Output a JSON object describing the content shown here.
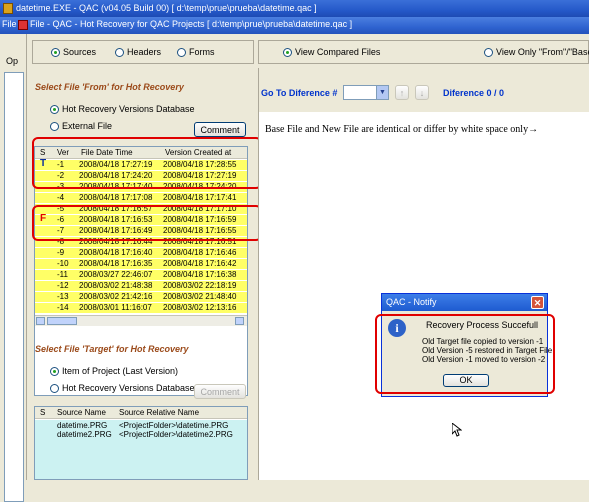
{
  "window": {
    "app_title": "datetime.EXE - QAC (v04.05 Build 00) [ d:\\temp\\prue\\prueba\\datetime.qac ]",
    "child_title": "File - QAC - Hot Recovery for QAC Projects [ d:\\temp\\prue\\prueba\\datetime.qac ]",
    "menu_file": "File",
    "side_label": "Op"
  },
  "top_tabs": {
    "sources": "Sources",
    "headers": "Headers",
    "forms": "Forms",
    "selected": "sources"
  },
  "view_options": {
    "compared": "View Compared Files",
    "only": "View Only \"From\"/\"Base\"",
    "selected": "compared"
  },
  "from_section": {
    "title": "Select File 'From' for Hot Recovery",
    "opt_db": "Hot Recovery Versions Database",
    "opt_ext": "External File",
    "selected": "db",
    "comment_button": "Comment",
    "columns": [
      "S",
      "Ver",
      "File Date Time",
      "Version Created at"
    ],
    "rows": [
      {
        "s": "T",
        "ver": "-1",
        "fdt": "2008/04/18 17:27:19",
        "created": "2008/04/18 17:28:55"
      },
      {
        "s": "",
        "ver": "-2",
        "fdt": "2008/04/18 17:24:20",
        "created": "2008/04/18 17:27:19"
      },
      {
        "s": "",
        "ver": "-3",
        "fdt": "2008/04/18 17:17:40",
        "created": "2008/04/18 17:24:20"
      },
      {
        "s": "",
        "ver": "-4",
        "fdt": "2008/04/18 17:17:08",
        "created": "2008/04/18 17:17:41"
      },
      {
        "s": "",
        "ver": "-5",
        "fdt": "2008/04/18 17:16:57",
        "created": "2008/04/18 17:17:10"
      },
      {
        "s": "F",
        "ver": "-6",
        "fdt": "2008/04/18 17:16:53",
        "created": "2008/04/18 17:16:59"
      },
      {
        "s": "",
        "ver": "-7",
        "fdt": "2008/04/18 17:16:49",
        "created": "2008/04/18 17:16:55"
      },
      {
        "s": "",
        "ver": "-8",
        "fdt": "2008/04/18 17:16:44",
        "created": "2008/04/18 17:16:51"
      },
      {
        "s": "",
        "ver": "-9",
        "fdt": "2008/04/18 17:16:40",
        "created": "2008/04/18 17:16:46"
      },
      {
        "s": "",
        "ver": "-10",
        "fdt": "2008/04/18 17:16:35",
        "created": "2008/04/18 17:16:42"
      },
      {
        "s": "",
        "ver": "-11",
        "fdt": "2008/03/27 22:46:07",
        "created": "2008/04/18 17:16:38"
      },
      {
        "s": "",
        "ver": "-12",
        "fdt": "2008/03/02 21:48:38",
        "created": "2008/03/02 22:18:19"
      },
      {
        "s": "",
        "ver": "-13",
        "fdt": "2008/03/02 21:42:16",
        "created": "2008/03/02 21:48:40"
      },
      {
        "s": "",
        "ver": "-14",
        "fdt": "2008/03/01 11:16:07",
        "created": "2008/03/02 12:13:16"
      }
    ]
  },
  "target_section": {
    "title": "Select File 'Target' for Hot Recovery",
    "opt_item": "Item of Project (Last Version)",
    "opt_db": "Hot Recovery Versions Database",
    "selected": "item",
    "comment_button": "Comment",
    "columns": [
      "S",
      "Source Name",
      "Source Relative Name"
    ],
    "rows": [
      {
        "name": "datetime.PRG",
        "rel": "<ProjectFolder>\\datetime.PRG"
      },
      {
        "name": "datetime2.PRG",
        "rel": "<ProjectFolder>\\datetime2.PRG"
      }
    ]
  },
  "diff": {
    "goto_label": "Go To Diference #",
    "counter": "Diference 0 / 0",
    "message": "Base File and New File are identical or differ by white space only→"
  },
  "notify": {
    "title": "QAC - Notify",
    "heading": "Recovery Process Succefull",
    "lines": [
      "Old Target file copied to version -1",
      "Old Version -5 restored in Target File",
      "Old Version -1 moved to version -2"
    ],
    "ok": "OK"
  },
  "colors": {
    "highlight": "#ffff66",
    "annotation": "#e00000",
    "link": "#0033cc"
  }
}
